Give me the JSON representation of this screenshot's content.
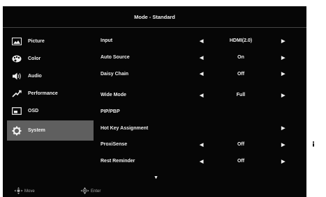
{
  "header": {
    "title": "Mode - Standard"
  },
  "sidebar": {
    "items": [
      {
        "label": "Picture",
        "icon": "picture-icon"
      },
      {
        "label": "Color",
        "icon": "palette-icon"
      },
      {
        "label": "Audio",
        "icon": "speaker-icon"
      },
      {
        "label": "Performance",
        "icon": "performance-icon"
      },
      {
        "label": "OSD",
        "icon": "osd-icon"
      },
      {
        "label": "System",
        "icon": "gear-icon",
        "selected": true
      }
    ]
  },
  "menu": {
    "rows": [
      {
        "label": "Input",
        "value": "HDMI(2.0)",
        "left_arrow": "◀",
        "right_arrow": "▶"
      },
      {
        "label": "Auto Source",
        "value": "On",
        "left_arrow": "◀",
        "right_arrow": "▶"
      },
      {
        "label": "Daisy Chain",
        "value": "Off",
        "left_arrow": "◀",
        "right_arrow": "▶"
      },
      {
        "label": "Wide Mode",
        "value": "Full",
        "left_arrow": "◀",
        "right_arrow": "▶"
      },
      {
        "label": "PIP/PBP",
        "value": "",
        "left_arrow": "",
        "right_arrow": ""
      },
      {
        "label": "Hot Key Assignment",
        "value": "",
        "left_arrow": "",
        "right_arrow": "▶"
      },
      {
        "label": "ProxiSense",
        "value": "Off",
        "left_arrow": "◀",
        "right_arrow": "▶"
      },
      {
        "label": "Rest Reminder",
        "value": "Off",
        "left_arrow": "◀",
        "right_arrow": "▶"
      }
    ],
    "scroll_indicator": "▼"
  },
  "footer": {
    "move_label": "Move",
    "enter_label": "Enter"
  },
  "hotkeys": [
    {
      "icon": "info-icon"
    },
    {
      "icon": "menu-grid-icon"
    },
    {
      "icon": "close-icon"
    }
  ],
  "colors": {
    "osd_bg": "#060606",
    "selected_bg": "#5f5f5f",
    "text": "#f0f0f0"
  }
}
